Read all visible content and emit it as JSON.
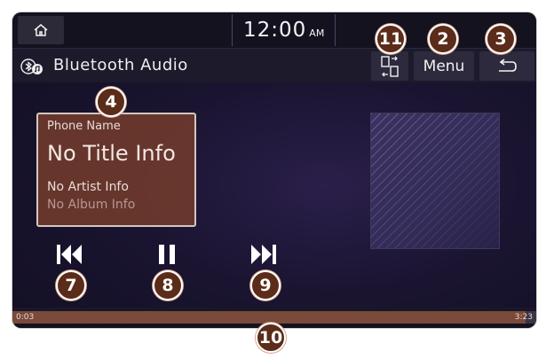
{
  "status_bar": {
    "clock_time": "12:00",
    "clock_ampm": "AM",
    "home_icon": "home-icon"
  },
  "title_bar": {
    "source_icon": "bluetooth-music-icon",
    "title": "Bluetooth Audio",
    "switch_icon": "device-switch-icon",
    "menu_label": "Menu",
    "back_icon": "back-arrow-icon"
  },
  "track_info": {
    "phone_name": "Phone Name",
    "title": "No Title Info",
    "artist": "No Artist Info",
    "album": "No Album Info"
  },
  "controls": {
    "previous_icon": "skip-previous-icon",
    "pause_icon": "pause-icon",
    "next_icon": "skip-next-icon"
  },
  "progress": {
    "elapsed": "0:03",
    "total": "3:23",
    "fraction": 0.98
  },
  "callouts": {
    "menu": "2",
    "back": "3",
    "track_info": "4",
    "previous": "7",
    "pause": "8",
    "next": "9",
    "progress": "10",
    "switch": "11"
  },
  "colors": {
    "accent": "#7a4a3a",
    "callout": "#5b2c1a"
  }
}
